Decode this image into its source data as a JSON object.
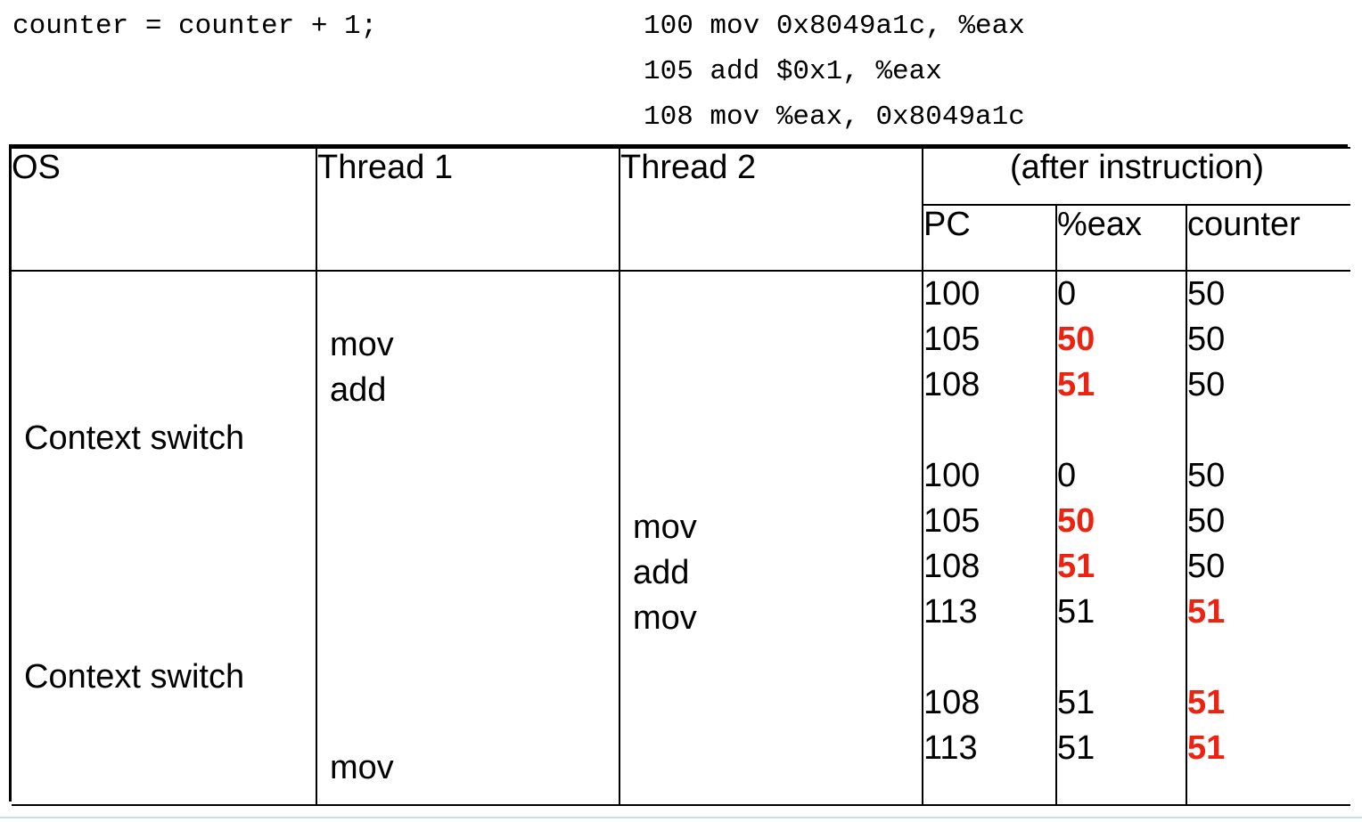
{
  "code": {
    "c_source": "counter = counter + 1;",
    "asm": [
      "100 mov 0x8049a1c, %eax",
      "105 add $0x1, %eax",
      "108 mov %eax, 0x8049a1c"
    ],
    "asm_text": "100 mov 0x8049a1c, %eax\n105 add $0x1, %eax\n108 mov %eax, 0x8049a1c"
  },
  "table": {
    "headers": {
      "os": "OS",
      "thread1": "Thread 1",
      "thread2": "Thread 2",
      "after_instruction": "(after instruction)",
      "pc": "PC",
      "eax": "%eax",
      "counter": "counter"
    },
    "os_events": [
      {
        "label": "Context switch"
      },
      {
        "label": "Context switch"
      }
    ],
    "thread1_ops": [
      {
        "label": "mov"
      },
      {
        "label": "add"
      },
      {
        "label": "mov"
      }
    ],
    "thread2_ops": [
      {
        "label": "mov"
      },
      {
        "label": "add"
      },
      {
        "label": "mov"
      }
    ],
    "pc_column": "100\n105\n108\n\n100\n105\n108\n113\n\n108\n113",
    "eax_column_note": "values 50 and 51 are red bold where the register is updated",
    "counter_column_note": "values 51 are red bold where memory is updated",
    "rows": [
      {
        "pc": "100",
        "eax": "0",
        "eax_red": false,
        "counter": "50",
        "counter_red": false
      },
      {
        "pc": "105",
        "eax": "50",
        "eax_red": true,
        "counter": "50",
        "counter_red": false
      },
      {
        "pc": "108",
        "eax": "51",
        "eax_red": true,
        "counter": "50",
        "counter_red": false
      },
      {
        "pc": "",
        "eax": "",
        "eax_red": false,
        "counter": "",
        "counter_red": false
      },
      {
        "pc": "100",
        "eax": "0",
        "eax_red": false,
        "counter": "50",
        "counter_red": false
      },
      {
        "pc": "105",
        "eax": "50",
        "eax_red": true,
        "counter": "50",
        "counter_red": false
      },
      {
        "pc": "108",
        "eax": "51",
        "eax_red": true,
        "counter": "50",
        "counter_red": false
      },
      {
        "pc": "113",
        "eax": "51",
        "eax_red": false,
        "counter": "51",
        "counter_red": true
      },
      {
        "pc": "",
        "eax": "",
        "eax_red": false,
        "counter": "",
        "counter_red": false
      },
      {
        "pc": "108",
        "eax": "51",
        "eax_red": false,
        "counter": "51",
        "counter_red": true
      },
      {
        "pc": "113",
        "eax": "51",
        "eax_red": false,
        "counter": "51",
        "counter_red": true
      }
    ]
  },
  "colors": {
    "highlight": "#ee2211",
    "border": "#000000",
    "accent_rule": "#bfe3e0",
    "background": "#ffffff"
  }
}
